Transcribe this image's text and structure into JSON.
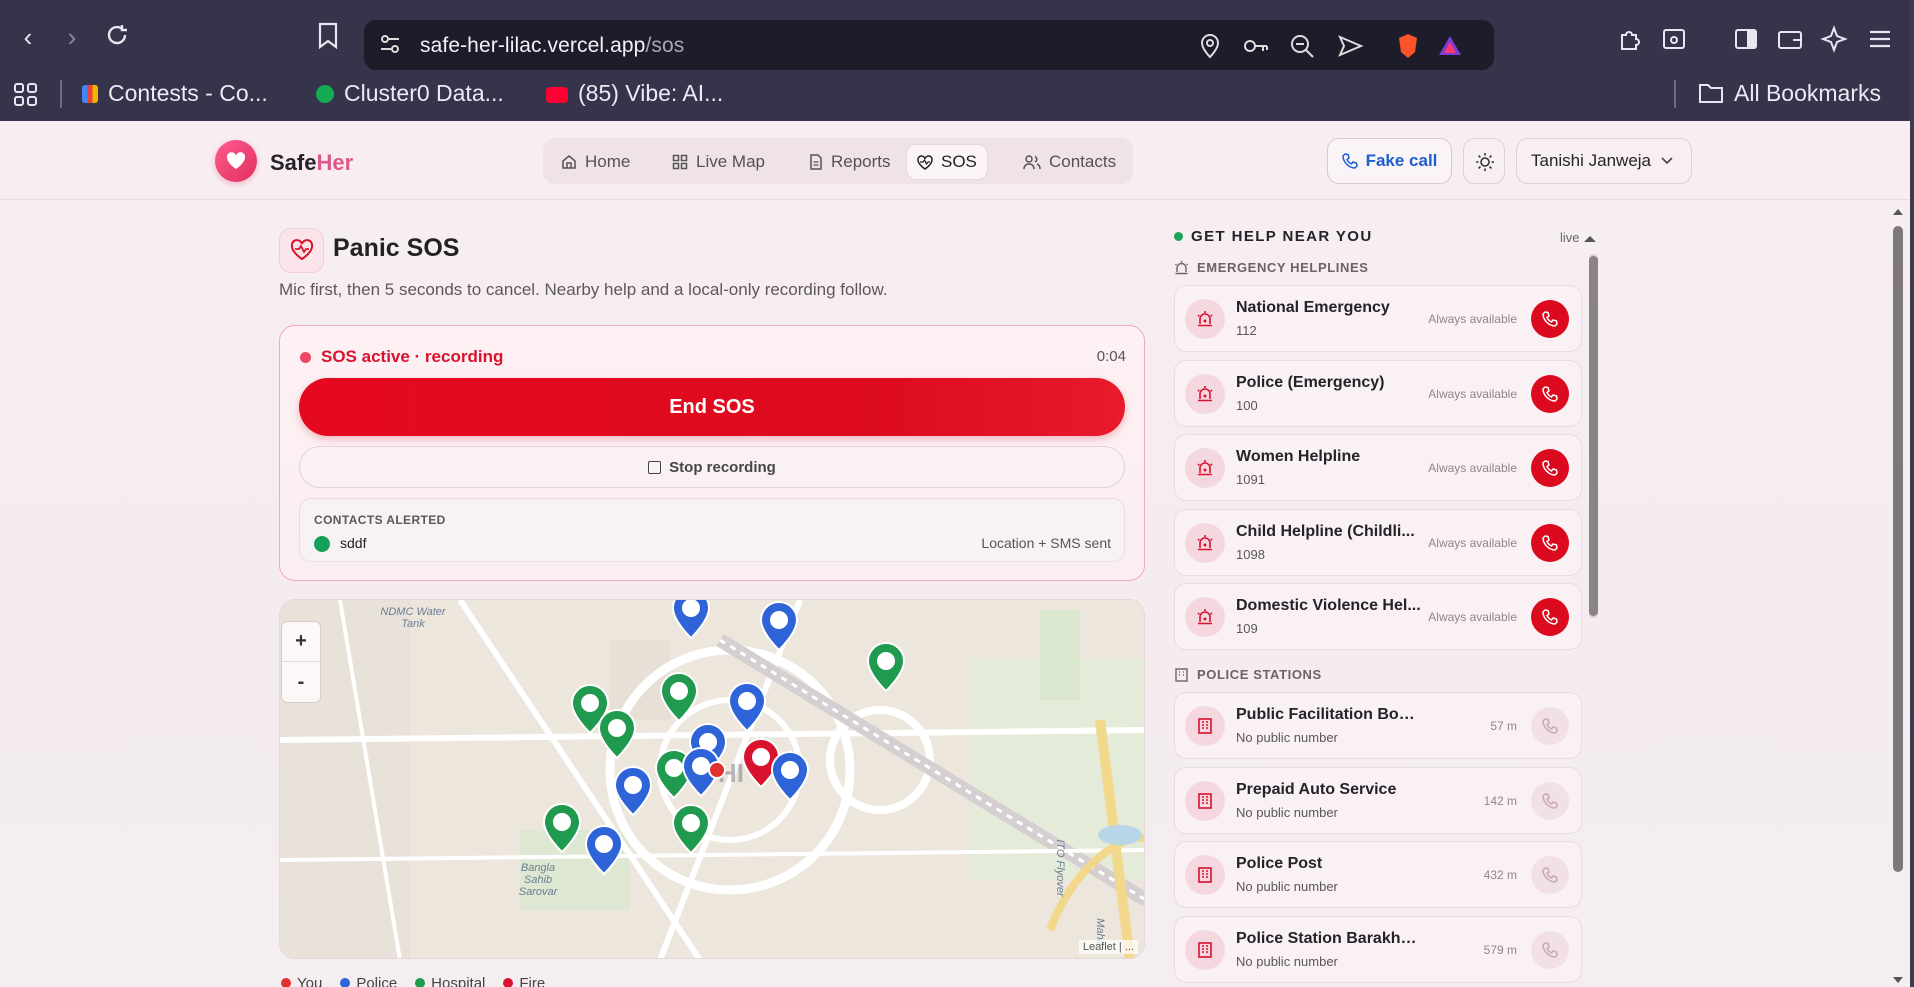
{
  "browser": {
    "url_host": "safe-her-lilac.vercel.app",
    "url_path": "/sos",
    "bookmarks": [
      {
        "label": "Contests - Co...",
        "color": "#f4b400"
      },
      {
        "label": "Cluster0 Data...",
        "color": "#13aa52"
      },
      {
        "label": "(85) Vibe: AI...",
        "color": "#ff0033"
      }
    ],
    "all_bookmarks": "All Bookmarks"
  },
  "app": {
    "brand_a": "Safe",
    "brand_b": "Her",
    "nav": [
      {
        "label": "Home"
      },
      {
        "label": "Live Map"
      },
      {
        "label": "Reports"
      },
      {
        "label": "SOS"
      },
      {
        "label": "Contacts"
      }
    ],
    "fake_call": "Fake call",
    "user": "Tanishi Janweja"
  },
  "sos": {
    "title": "Panic SOS",
    "subtitle": "Mic first, then 5 seconds to cancel. Nearby help and a local-only recording follow.",
    "status": "SOS active · recording",
    "timer": "0:04",
    "end_label": "End SOS",
    "stop_label": "Stop recording",
    "contacts_header": "CONTACTS ALERTED",
    "contact_name": "sddf",
    "contact_status": "Location + SMS sent"
  },
  "map": {
    "labels": [
      "NDMC Water Tank",
      "Bangla Sahib Sarovar",
      "ITO Flyover",
      "Maha"
    ],
    "attribution": "Leaflet | ...",
    "legend": [
      "You",
      "Police",
      "Hospital",
      "Fire"
    ],
    "legend_colors": [
      "#e03131",
      "#2e64d8",
      "#1f9a4e",
      "#d9122e"
    ]
  },
  "help": {
    "title": "GET HELP NEAR YOU",
    "live": "live",
    "helplines_header": "EMERGENCY HELPLINES",
    "helplines": [
      {
        "name": "National Emergency",
        "number": "112",
        "avail": "Always available"
      },
      {
        "name": "Police (Emergency)",
        "number": "100",
        "avail": "Always available"
      },
      {
        "name": "Women Helpline",
        "number": "1091",
        "avail": "Always available"
      },
      {
        "name": "Child Helpline (Childli...",
        "number": "1098",
        "avail": "Always available"
      },
      {
        "name": "Domestic Violence Hel...",
        "number": "109",
        "avail": "Always available"
      }
    ],
    "police_header": "POLICE STATIONS",
    "stations": [
      {
        "name": "Public Facilitation Booth",
        "number": "No public number",
        "dist": "57 m"
      },
      {
        "name": "Prepaid Auto Service",
        "number": "No public number",
        "dist": "142 m"
      },
      {
        "name": "Police Post",
        "number": "No public number",
        "dist": "432 m"
      },
      {
        "name": "Police Station Barakhamba R...",
        "number": "No public number",
        "dist": "579 m"
      }
    ]
  }
}
